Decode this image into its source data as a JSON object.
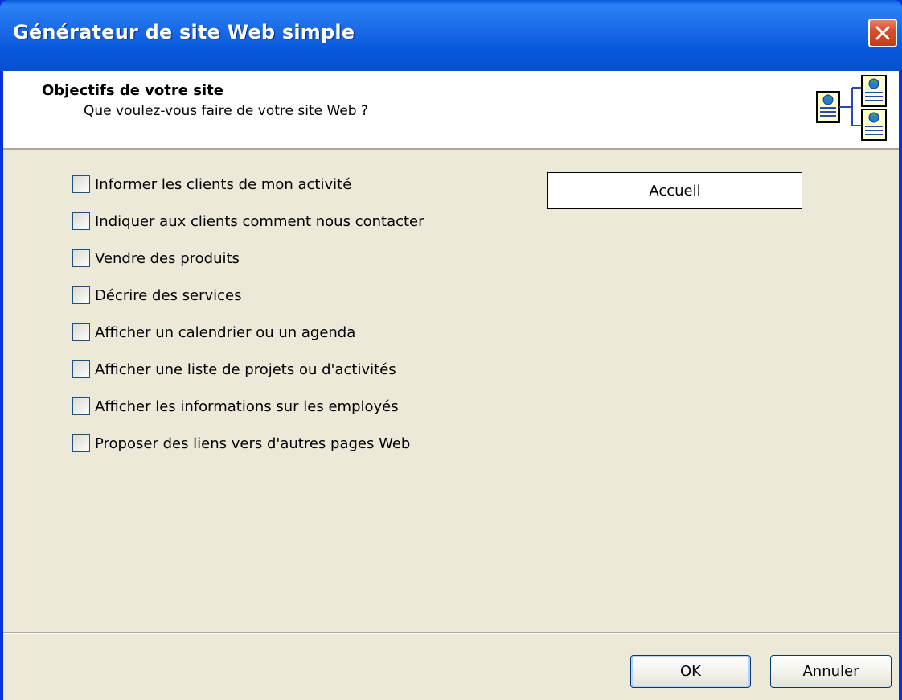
{
  "window": {
    "title": "Générateur de site Web simple"
  },
  "header": {
    "title": "Objectifs de votre site",
    "subtitle": "Que voulez-vous faire de votre site Web ?",
    "icon": "site-pages-icon"
  },
  "options": [
    {
      "label": "Informer les clients de mon activité",
      "checked": false
    },
    {
      "label": "Indiquer aux clients comment nous contacter",
      "checked": false
    },
    {
      "label": "Vendre des produits",
      "checked": false
    },
    {
      "label": "Décrire des services",
      "checked": false
    },
    {
      "label": "Afficher un calendrier ou un agenda",
      "checked": false
    },
    {
      "label": "Afficher une liste de projets ou d'activités",
      "checked": false
    },
    {
      "label": "Afficher les informations sur les employés",
      "checked": false
    },
    {
      "label": "Proposer des liens vers d'autres pages Web",
      "checked": false
    }
  ],
  "pages": [
    {
      "label": "Accueil"
    }
  ],
  "buttons": {
    "ok_label": "OK",
    "cancel_label": "Annuler"
  },
  "colors": {
    "titlebar": "#0858dd",
    "dialog_bg": "#ece9d8",
    "close_button": "#d6502f"
  }
}
